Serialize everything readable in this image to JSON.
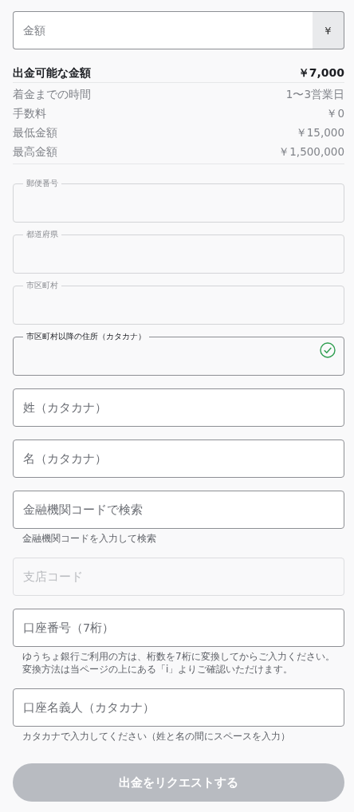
{
  "amount_field": {
    "placeholder": "金額",
    "currency": "¥"
  },
  "summary": {
    "available": {
      "label": "出金可能な金額",
      "value": "￥7,000"
    },
    "rows": [
      {
        "label": "着金までの時間",
        "value": "1〜3営業日"
      },
      {
        "label": "手数料",
        "value": "￥0"
      },
      {
        "label": "最低金額",
        "value": "￥15,000"
      },
      {
        "label": "最高金額",
        "value": "￥1,500,000"
      }
    ]
  },
  "fields": [
    {
      "kind": "outlined",
      "label": "郵便番号",
      "disabled": true
    },
    {
      "kind": "outlined",
      "label": "都道府県",
      "disabled": true
    },
    {
      "kind": "outlined",
      "label": "市区町村",
      "disabled": true
    },
    {
      "kind": "outlined",
      "label": "市区町村以降の住所（カタカナ）",
      "disabled": false,
      "valid": true
    },
    {
      "kind": "plain",
      "placeholder": "姓（カタカナ）",
      "disabled": false
    },
    {
      "kind": "plain",
      "placeholder": "名（カタカナ）",
      "disabled": false
    },
    {
      "kind": "plain",
      "placeholder": "金融機関コードで検索",
      "disabled": false,
      "helper": "金融機関コードを入力して検索"
    },
    {
      "kind": "plain",
      "placeholder": "支店コード",
      "disabled": true
    },
    {
      "kind": "plain",
      "placeholder": "口座番号（7桁）",
      "disabled": false,
      "helper": "ゆうちょ銀行ご利用の方は、桁数を7桁に変換してからご入力ください。変換方法は当ページの上にある「i」よりご確認いただけます。"
    },
    {
      "kind": "plain",
      "placeholder": "口座名義人（カタカナ）",
      "disabled": false,
      "helper": "カタカナで入力してください（姓と名の間にスペースを入力）"
    }
  ],
  "submit": {
    "label": "出金をリクエストする",
    "disabled": true
  }
}
